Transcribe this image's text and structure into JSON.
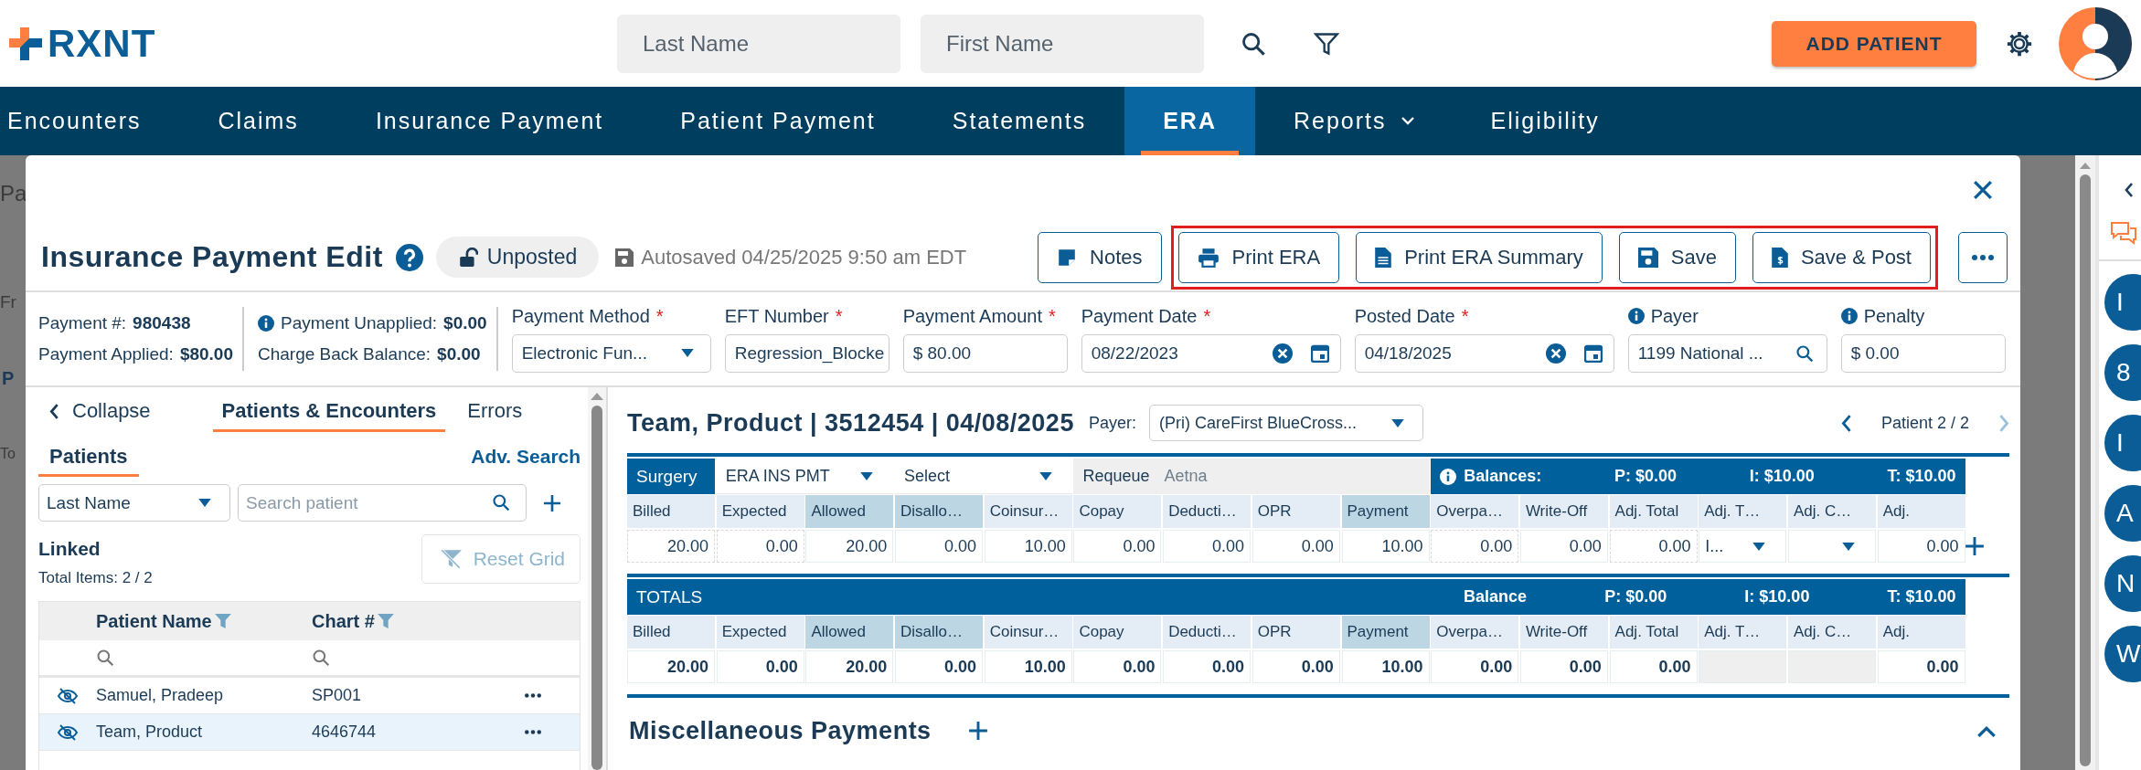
{
  "header": {
    "logo": "RXNT",
    "search_fields": [
      {
        "placeholder": "Last Name"
      },
      {
        "placeholder": "First Name"
      }
    ],
    "add_button": "ADD PATIENT"
  },
  "nav": [
    {
      "label": "Encounters",
      "selected": false,
      "has_menu": false
    },
    {
      "label": "Claims",
      "selected": false,
      "has_menu": false
    },
    {
      "label": "Insurance Payment",
      "selected": false,
      "has_menu": false
    },
    {
      "label": "Patient Payment",
      "selected": false,
      "has_menu": false
    },
    {
      "label": "Statements",
      "selected": false,
      "has_menu": false
    },
    {
      "label": "ERA",
      "selected": true,
      "has_menu": false
    },
    {
      "label": "Reports",
      "selected": false,
      "has_menu": true
    },
    {
      "label": "Eligibility",
      "selected": false,
      "has_menu": false
    }
  ],
  "background": {
    "title": "Pa",
    "filter_label": "Fr",
    "tab": "P",
    "total": "To"
  },
  "modal": {
    "title": "Insurance Payment Edit",
    "status": "Unposted",
    "posted": false,
    "autosaved": "Autosaved 04/25/2025 9:50 am EDT",
    "buttons": [
      {
        "label": "Notes",
        "kind": "note"
      }
    ],
    "framed_buttons": [
      {
        "label": "Print ERA",
        "kind": "printer"
      },
      {
        "label": "Print ERA Summary",
        "kind": "document"
      },
      {
        "label": "Save",
        "kind": "disk"
      },
      {
        "label": "Save & Post",
        "kind": "invoice"
      }
    ],
    "summary": [
      [
        {
          "label": "Payment #:",
          "value": "980438",
          "kind": "plain"
        },
        {
          "label": "Payment Applied:",
          "value": "$80.00",
          "kind": "plain"
        }
      ],
      [
        {
          "label": "Payment Unapplied:",
          "value": "$0.00",
          "kind": "info"
        },
        {
          "label": "Charge Back Balance:",
          "value": "$0.00",
          "kind": "plain"
        }
      ]
    ],
    "fields": [
      {
        "label": "Payment Method",
        "required_mark": "*",
        "kind": "select",
        "value": "Electronic Fun..."
      },
      {
        "label": "EFT Number",
        "required_mark": "*",
        "kind": "text",
        "value": "Regression_Blocke"
      },
      {
        "label": "Payment Amount",
        "required_mark": "*",
        "kind": "text",
        "value": "$ 80.00"
      },
      {
        "label": "Payment Date",
        "required_mark": "*",
        "kind": "date",
        "value": "08/22/2023"
      },
      {
        "label": "Posted Date",
        "required_mark": "*",
        "kind": "date",
        "value": "04/18/2025"
      },
      {
        "label": "Payer",
        "info": true,
        "kind": "search",
        "value": "1199 National ..."
      },
      {
        "label": "Penalty",
        "info": true,
        "kind": "text",
        "value": "$ 0.00"
      }
    ]
  },
  "patients_panel": {
    "collapse": "Collapse",
    "tabs": [
      {
        "label": "Patients & Encounters",
        "selected": true
      },
      {
        "label": "Errors",
        "selected": false
      }
    ],
    "subtab": {
      "label": "Patients",
      "selected": true
    },
    "adv_search": "Adv. Search",
    "filter_select": "Last Name",
    "search_placeholder": "Search patient",
    "section": "Linked",
    "total": "Total Items: 2 / 2",
    "reset_button": {
      "label": "Reset Grid",
      "disabled": true
    },
    "columns": [
      "Patient Name",
      "Chart #"
    ],
    "rows": [
      {
        "name": "Samuel, Pradeep",
        "chart": "SP001",
        "selected": false
      },
      {
        "name": "Team, Product",
        "chart": "4646744",
        "selected": true
      }
    ]
  },
  "encounter": {
    "title": "Team, Product | 3512454 | 04/08/2025",
    "payer_label": "Payer:",
    "payer": "(Pri) CareFirst BlueCross...",
    "pager": "Patient 2 / 2",
    "has_previous": true,
    "has_next": false,
    "line_table": {
      "label": "Surgery",
      "selects": [
        "ERA INS PMT",
        "Select"
      ],
      "requeue_label": "Requeue",
      "requeue_value": "Aetna",
      "balances_label": "Balances:",
      "balances": [
        "P: $0.00",
        "I: $10.00",
        "T: $10.00"
      ],
      "columns": [
        {
          "label": "Billed",
          "highlighted": false
        },
        {
          "label": "Expected",
          "highlighted": false
        },
        {
          "label": "Allowed",
          "highlighted": true
        },
        {
          "label": "Disallo…",
          "highlighted": true
        },
        {
          "label": "Coinsur…",
          "highlighted": false
        },
        {
          "label": "Copay",
          "highlighted": false
        },
        {
          "label": "Deducti…",
          "highlighted": false
        },
        {
          "label": "OPR",
          "highlighted": false
        },
        {
          "label": "Payment",
          "highlighted": true
        },
        {
          "label": "Overpa…",
          "highlighted": false
        },
        {
          "label": "Write-Off",
          "highlighted": false
        },
        {
          "label": "Adj. Total",
          "highlighted": false
        },
        {
          "label": "Adj. T…",
          "highlighted": false
        },
        {
          "label": "Adj. C…",
          "highlighted": false
        },
        {
          "label": "Adj.",
          "highlighted": false
        }
      ],
      "cells": [
        {
          "kind": "readonly",
          "value": "20.00"
        },
        {
          "kind": "readonly",
          "value": "0.00"
        },
        {
          "kind": "input",
          "value": "20.00"
        },
        {
          "kind": "input",
          "value": "0.00"
        },
        {
          "kind": "input",
          "value": "10.00"
        },
        {
          "kind": "input",
          "value": "0.00"
        },
        {
          "kind": "input",
          "value": "0.00"
        },
        {
          "kind": "input",
          "value": "0.00"
        },
        {
          "kind": "input",
          "value": "10.00"
        },
        {
          "kind": "readonly",
          "value": "0.00"
        },
        {
          "kind": "input",
          "value": "0.00"
        },
        {
          "kind": "readonly",
          "value": "0.00"
        },
        {
          "kind": "select",
          "value": "I..."
        },
        {
          "kind": "select"
        },
        {
          "kind": "input",
          "value": "0.00"
        }
      ]
    },
    "totals": {
      "label": "TOTALS",
      "balance_label": "Balance",
      "balances": [
        "P: $0.00",
        "I: $10.00",
        "T: $10.00"
      ],
      "columns": [
        {
          "label": "Billed",
          "highlighted": false
        },
        {
          "label": "Expected",
          "highlighted": false
        },
        {
          "label": "Allowed",
          "highlighted": true
        },
        {
          "label": "Disallo…",
          "highlighted": true
        },
        {
          "label": "Coinsur…",
          "highlighted": false
        },
        {
          "label": "Copay",
          "highlighted": false
        },
        {
          "label": "Deducti…",
          "highlighted": false
        },
        {
          "label": "OPR",
          "highlighted": false
        },
        {
          "label": "Payment",
          "highlighted": true
        },
        {
          "label": "Overpa…",
          "highlighted": false
        },
        {
          "label": "Write-Off",
          "highlighted": false
        },
        {
          "label": "Adj. Total",
          "highlighted": false
        },
        {
          "label": "Adj. T…",
          "highlighted": false
        },
        {
          "label": "Adj. C…",
          "highlighted": false
        },
        {
          "label": "Adj.",
          "highlighted": false
        }
      ],
      "cells": [
        {
          "kind": "value",
          "value": "20.00"
        },
        {
          "kind": "value",
          "value": "0.00"
        },
        {
          "kind": "value",
          "value": "20.00"
        },
        {
          "kind": "value",
          "value": "0.00"
        },
        {
          "kind": "value",
          "value": "10.00"
        },
        {
          "kind": "value",
          "value": "0.00"
        },
        {
          "kind": "value",
          "value": "0.00"
        },
        {
          "kind": "value",
          "value": "0.00"
        },
        {
          "kind": "value",
          "value": "10.00"
        },
        {
          "kind": "value",
          "value": "0.00"
        },
        {
          "kind": "value",
          "value": "0.00"
        },
        {
          "kind": "value",
          "value": "0.00"
        },
        {
          "kind": "empty"
        },
        {
          "kind": "empty"
        },
        {
          "kind": "value",
          "value": "0.00"
        }
      ]
    }
  },
  "misc_payments": {
    "title": "Miscellaneous Payments",
    "expanded": true
  },
  "right_sidebar": {
    "badges": [
      "I",
      "8",
      "I",
      "A",
      "N",
      "W"
    ]
  }
}
